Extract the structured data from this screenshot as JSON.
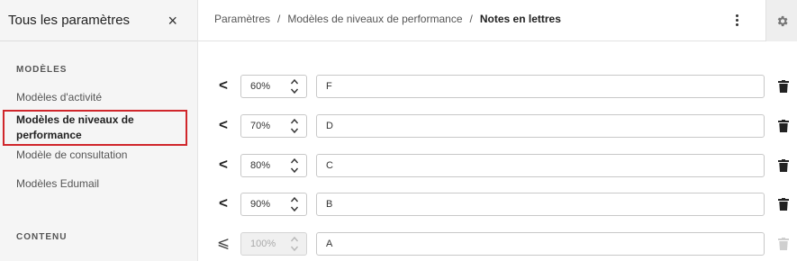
{
  "sidebar": {
    "title": "Tous les paramètres",
    "close_icon": "×",
    "sections": [
      {
        "label": "MODÈLES"
      },
      {
        "label": "CONTENU"
      }
    ],
    "items": [
      {
        "label": "Modèles d'activité"
      },
      {
        "label": "Modèles de niveaux de performance",
        "active": true
      },
      {
        "label": "Modèle de consultation"
      },
      {
        "label": "Modèles Edumail"
      }
    ]
  },
  "breadcrumb": {
    "items": [
      "Paramètres",
      "Modèles de niveaux de performance"
    ],
    "separator": "/",
    "current": "Notes en lettres"
  },
  "rows": [
    {
      "operator": "<",
      "threshold": "60%",
      "grade": "F",
      "disabled": false
    },
    {
      "operator": "<",
      "threshold": "70%",
      "grade": "D",
      "disabled": false
    },
    {
      "operator": "<",
      "threshold": "80%",
      "grade": "C",
      "disabled": false
    },
    {
      "operator": "<",
      "threshold": "90%",
      "grade": "B",
      "disabled": false
    },
    {
      "operator": "⩽",
      "threshold": "100%",
      "grade": "A",
      "disabled": true
    }
  ],
  "icons": {
    "close": "close-icon",
    "more": "more-vertical-icon",
    "settings": "gear-icon",
    "stepper": "chevron-up-down-icon",
    "delete": "trash-icon"
  },
  "colors": {
    "highlight": "#d0262b",
    "sidebar_bg": "#f5f5f5",
    "trash_disabled": "#c8c8c8"
  }
}
